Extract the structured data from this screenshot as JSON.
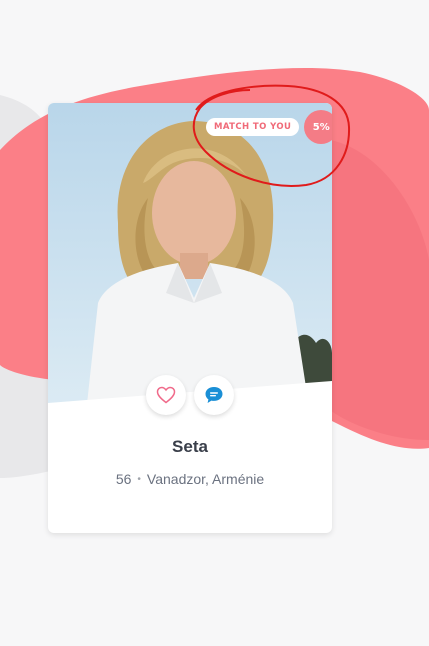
{
  "profile": {
    "name": "Seta",
    "age": "56",
    "location": "Vanadzor, Arménie",
    "separator": "•"
  },
  "match": {
    "label": "MATCH TO YOU",
    "percent": "5%"
  },
  "actions": {
    "like_icon": "heart-icon",
    "chat_icon": "chat-bubble-icon"
  },
  "colors": {
    "brand": "#f47c86",
    "blob": "#fb7f87",
    "chat_icon": "#1a8fd6",
    "annotation": "#e01b1b"
  }
}
